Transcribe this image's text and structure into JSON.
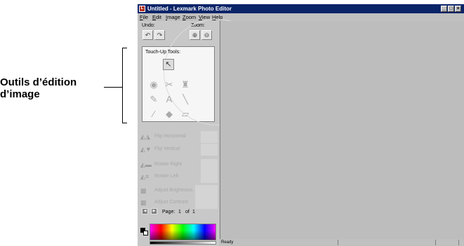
{
  "callout": {
    "line1": "Outils d’édition",
    "line2": "d’image"
  },
  "window": {
    "title": "Untitled - Lexmark Photo Editor",
    "controls": [
      "minimize",
      "maximize",
      "close"
    ]
  },
  "menu": [
    "File",
    "Edit",
    "Image",
    "Zoom",
    "View",
    "Help"
  ],
  "panel": {
    "undo_label": "Undo:",
    "zoom_label": "Zoom:",
    "touchup_label": "Touch-Up Tools:",
    "tools": [
      "select-arrow-icon",
      "red-eye-icon",
      "scissors-icon",
      "stamp-icon",
      "pencil-icon",
      "text-icon",
      "line-icon",
      "eyedropper-icon",
      "fill-bucket-icon",
      "eraser-icon"
    ],
    "operations": [
      {
        "label": "Flip Horizontal",
        "icon": "flip-horizontal-icon"
      },
      {
        "label": "Flip Vertical",
        "icon": "flip-vertical-icon"
      },
      {
        "label": "Rotate Right",
        "icon": "rotate-right-icon"
      },
      {
        "label": "Rotate Left",
        "icon": "rotate-left-icon"
      },
      {
        "label": "Adjust Brightness",
        "icon": "brightness-icon"
      },
      {
        "label": "Adjust Contrast",
        "icon": "contrast-icon"
      }
    ],
    "page_label": "Page:",
    "page_current": "1",
    "page_of": "of",
    "page_total": "1"
  },
  "status": {
    "text": "Ready"
  },
  "colors": {
    "titlebar": "#0a2468",
    "canvas": "#bdbdbd",
    "panel": "#c8c8c8"
  }
}
